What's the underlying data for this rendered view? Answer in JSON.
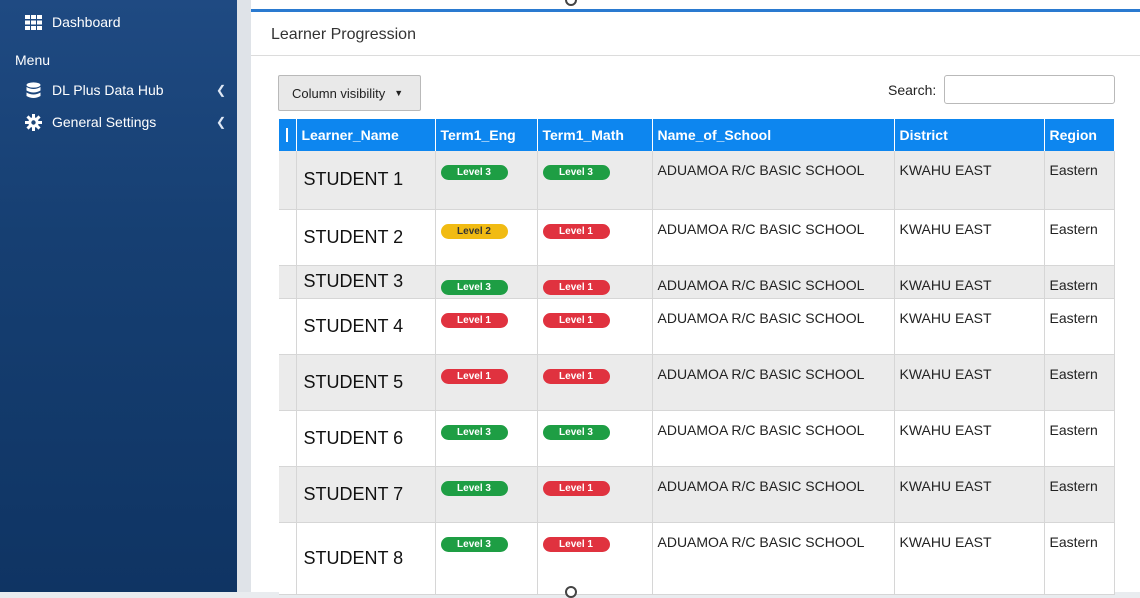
{
  "sidebar": {
    "dashboard_label": "Dashboard",
    "menu_heading": "Menu",
    "items": [
      {
        "label": "DL Plus Data Hub",
        "icon": "database-icon"
      },
      {
        "label": "General Settings",
        "icon": "gear-icon"
      }
    ]
  },
  "panel": {
    "title": "Learner Progression",
    "column_visibility_label": "Column visibility",
    "search_label": "Search:"
  },
  "table": {
    "headers": [
      "Learner_Name",
      "Term1_Eng",
      "Term1_Math",
      "Name_of_School",
      "District",
      "Region"
    ],
    "rows": [
      {
        "name": "STUDENT 1",
        "eng": "Level 3",
        "math": "Level 3",
        "school": "ADUAMOA R/C BASIC SCHOOL",
        "district": "KWAHU EAST",
        "region": "Eastern"
      },
      {
        "name": "STUDENT 2",
        "eng": "Level 2",
        "math": "Level 1",
        "school": "ADUAMOA R/C BASIC SCHOOL",
        "district": "KWAHU EAST",
        "region": "Eastern"
      },
      {
        "name": "STUDENT 3",
        "eng": "Level 3",
        "math": "Level 1",
        "school": "ADUAMOA R/C BASIC SCHOOL",
        "district": "KWAHU EAST",
        "region": "Eastern"
      },
      {
        "name": "STUDENT 4",
        "eng": "Level 1",
        "math": "Level 1",
        "school": "ADUAMOA R/C BASIC SCHOOL",
        "district": "KWAHU EAST",
        "region": "Eastern"
      },
      {
        "name": "STUDENT 5",
        "eng": "Level 1",
        "math": "Level 1",
        "school": "ADUAMOA R/C BASIC SCHOOL",
        "district": "KWAHU EAST",
        "region": "Eastern"
      },
      {
        "name": "STUDENT 6",
        "eng": "Level 3",
        "math": "Level 3",
        "school": "ADUAMOA R/C BASIC SCHOOL",
        "district": "KWAHU EAST",
        "region": "Eastern"
      },
      {
        "name": "STUDENT 7",
        "eng": "Level 3",
        "math": "Level 1",
        "school": "ADUAMOA R/C BASIC SCHOOL",
        "district": "KWAHU EAST",
        "region": "Eastern"
      },
      {
        "name": "STUDENT 8",
        "eng": "Level 3",
        "math": "Level 1",
        "school": "ADUAMOA R/C BASIC SCHOOL",
        "district": "KWAHU EAST",
        "region": "Eastern"
      }
    ]
  },
  "colors": {
    "sidebar_top": "#1f4a82",
    "sidebar_bottom": "#0f3463",
    "header_blue": "#0d86ef",
    "level3": "#1e9e44",
    "level2": "#f1bb13",
    "level1": "#e0323f"
  }
}
